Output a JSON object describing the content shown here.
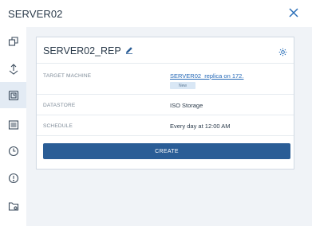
{
  "window": {
    "title": "SERVER02"
  },
  "sidebar": {
    "items": [
      {
        "icon": "machines-icon",
        "active": false
      },
      {
        "icon": "recovery-icon",
        "active": false
      },
      {
        "icon": "replication-icon",
        "active": true
      },
      {
        "icon": "activities-icon",
        "active": false
      },
      {
        "icon": "clock-icon",
        "active": false
      },
      {
        "icon": "alert-icon",
        "active": false
      },
      {
        "icon": "folder-settings-icon",
        "active": false
      }
    ]
  },
  "plan": {
    "name": "SERVER02_REP",
    "rows": [
      {
        "label": "TARGET MACHINE",
        "value": "SERVER02_replica on 172.",
        "badge": "New"
      },
      {
        "label": "DATASTORE",
        "value": "ISO Storage"
      },
      {
        "label": "SCHEDULE",
        "value": "Every day at 12:00 AM"
      }
    ],
    "create_label": "CREATE"
  },
  "colors": {
    "accent": "#2a5d96",
    "link": "#2468b7",
    "active_bg": "#e3ebf4",
    "panel_bg": "#f0f3f7"
  }
}
